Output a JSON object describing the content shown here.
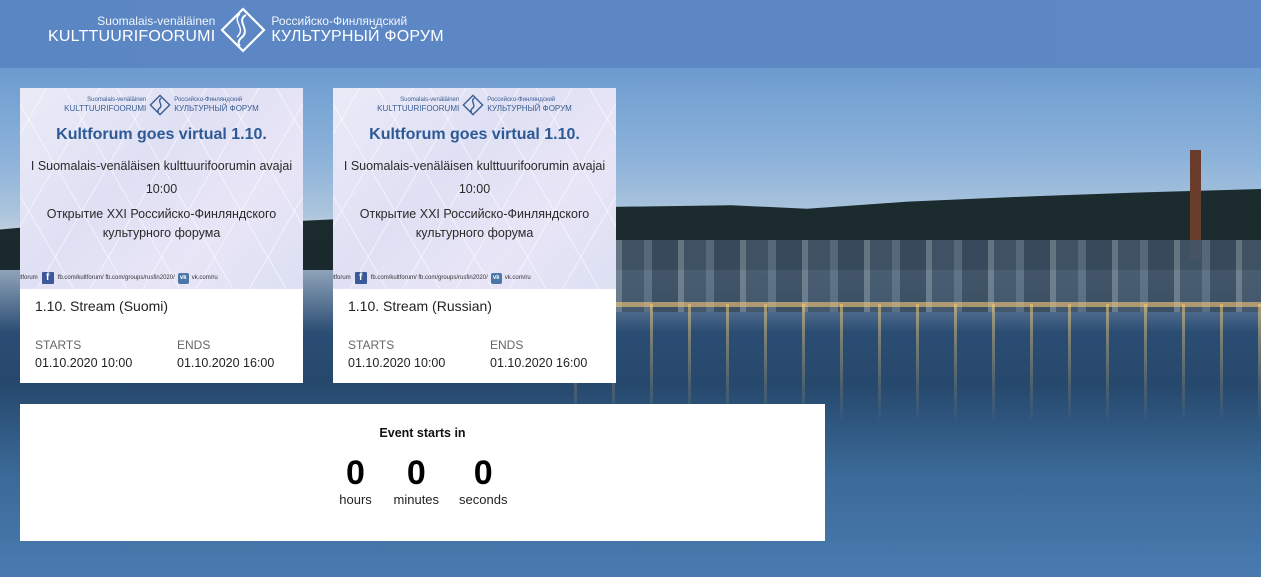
{
  "header": {
    "logo": {
      "fi_small": "Suomalais-venäläinen",
      "fi_big": "KULTTUURIFOORUMI",
      "ru_small": "Российско-Финляндский",
      "ru_big": "КУЛЬТУРНЫЙ ФОРУМ"
    }
  },
  "cards": [
    {
      "banner": {
        "logo_fi_small": "Suomalais-venäläinen",
        "logo_fi_big": "KULTTUURIFOORUMI",
        "logo_ru_small": "Российско-Финляндский",
        "logo_ru_big": "КУЛЬТУРНЫЙ ФОРУМ",
        "title": "Kultforum goes virtual 1.10.",
        "line_fi": "I Suomalais-venäläisen kulttuurifoorumin avajai",
        "time": "10:00",
        "line_ru1": "Открытие XXI Российско-Финляндского",
        "line_ru2": "культурного форума",
        "social_1": "ultforum",
        "social_2": "fb.com/kultforum/",
        "social_3": "fb.com/groups/rusfin2020/",
        "social_4": "vk.com/ru"
      },
      "title": "1.10. Stream (Suomi)",
      "starts_label": "STARTS",
      "starts_value": "01.10.2020 10:00",
      "ends_label": "ENDS",
      "ends_value": "01.10.2020 16:00"
    },
    {
      "banner": {
        "logo_fi_small": "Suomalais-venäläinen",
        "logo_fi_big": "KULTTUURIFOORUMI",
        "logo_ru_small": "Российско-Финляндский",
        "logo_ru_big": "КУЛЬТУРНЫЙ ФОРУМ",
        "title": "Kultforum goes virtual 1.10.",
        "line_fi": "I Suomalais-venäläisen kulttuurifoorumin avajai",
        "time": "10:00",
        "line_ru1": "Открытие XXI Российско-Финляндского",
        "line_ru2": "культурного форума",
        "social_1": "ultforum",
        "social_2": "fb.com/kultforum/",
        "social_3": "fb.com/groups/rusfin2020/",
        "social_4": "vk.com/ru"
      },
      "title": "1.10. Stream (Russian)",
      "starts_label": "STARTS",
      "starts_value": "01.10.2020 10:00",
      "ends_label": "ENDS",
      "ends_value": "01.10.2020 16:00"
    }
  ],
  "countdown": {
    "heading": "Event starts in",
    "hours": "0",
    "hours_label": "hours",
    "minutes": "0",
    "minutes_label": "minutes",
    "seconds": "0",
    "seconds_label": "seconds"
  },
  "colors": {
    "header_bg": "#5b86c4",
    "banner_title": "#2d5a95",
    "facebook": "#3b5998",
    "vk": "#4a76a8"
  },
  "icons": [
    "kultforum-logo-icon",
    "facebook-icon",
    "vk-icon"
  ]
}
